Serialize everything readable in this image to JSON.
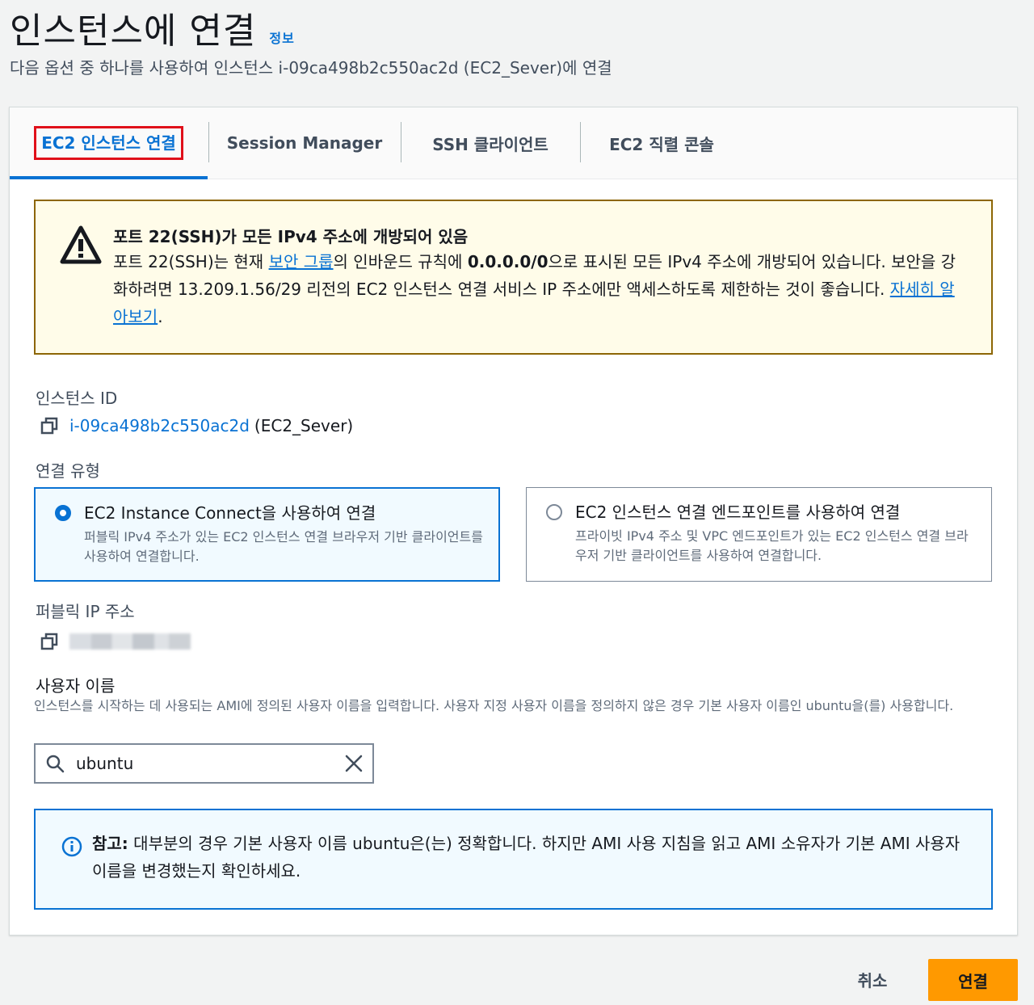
{
  "header": {
    "title": "인스턴스에 연결",
    "info_link": "정보",
    "description": "다음 옵션 중 하나를 사용하여 인스턴스 i-09ca498b2c550ac2d (EC2_Sever)에 연결"
  },
  "tabs": [
    {
      "label": "EC2 인스턴스 연결",
      "active": true
    },
    {
      "label": "Session Manager",
      "active": false
    },
    {
      "label": "SSH 클라이언트",
      "active": false
    },
    {
      "label": "EC2 직렬 콘솔",
      "active": false
    }
  ],
  "warning": {
    "title": "포트 22(SSH)가 모든 IPv4 주소에 개방되어 있음",
    "body_pre": "포트 22(SSH)는 현재 ",
    "body_link": "보안 그룹",
    "body_mid": "의 인바운드 규칙에 ",
    "body_bold": "0.0.0.0/0",
    "body_post": "으로 표시된 모든 IPv4 주소에 개방되어 있습니다. 보안을 강화하려면 13.209.1.56/29 리전의 EC2 인스턴스 연결 서비스 IP 주소에만 액세스하도록 제한하는 것이 좋습니다. ",
    "learn_more": "자세히 알아보기",
    "period": "."
  },
  "instance": {
    "label": "인스턴스 ID",
    "id": "i-09ca498b2c550ac2d",
    "name": "(EC2_Sever)"
  },
  "connection_type": {
    "label": "연결 유형",
    "options": [
      {
        "title": "EC2 Instance Connect을 사용하여 연결",
        "desc": "퍼블릭 IPv4 주소가 있는 EC2 인스턴스 연결 브라우저 기반 클라이언트를 사용하여 연결합니다.",
        "selected": true
      },
      {
        "title": "EC2 인스턴스 연결 엔드포인트를 사용하여 연결",
        "desc": "프라이빗 IPv4 주소 및 VPC 엔드포인트가 있는 EC2 인스턴스 연결 브라우저 기반 클라이언트를 사용하여 연결합니다.",
        "selected": false
      }
    ]
  },
  "public_ip": {
    "label": "퍼블릭 IP 주소"
  },
  "username": {
    "label": "사용자 이름",
    "description": "인스턴스를 시작하는 데 사용되는 AMI에 정의된 사용자 이름을 입력합니다. 사용자 지정 사용자 이름을 정의하지 않은 경우 기본 사용자 이름인 ubuntu을(를) 사용합니다.",
    "value": "ubuntu"
  },
  "note": {
    "label": "참고:",
    "text": " 대부분의 경우 기본 사용자 이름 ubuntu은(는) 정확합니다. 하지만 AMI 사용 지침을 읽고 AMI 소유자가 기본 AMI 사용자 이름을 변경했는지 확인하세요."
  },
  "footer": {
    "cancel": "취소",
    "connect": "연결"
  },
  "colors": {
    "accent": "#0972d3",
    "primary_button": "#ff9900",
    "warning_border": "#8d6605",
    "warning_bg": "#fffce9",
    "highlight_box": "#e0101a"
  }
}
